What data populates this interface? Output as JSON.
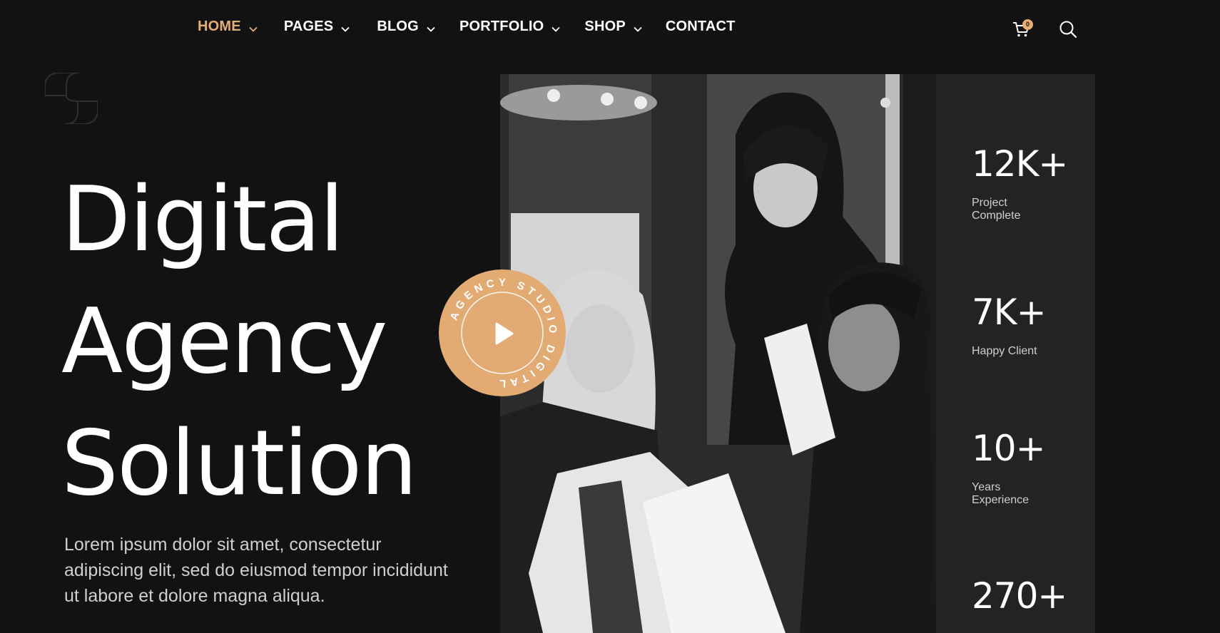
{
  "nav": {
    "items": [
      {
        "label": "HOME",
        "active": true,
        "has_dropdown": true
      },
      {
        "label": "PAGES",
        "active": false,
        "has_dropdown": true
      },
      {
        "label": "BLOG",
        "active": false,
        "has_dropdown": true
      },
      {
        "label": "PORTFOLIO",
        "active": false,
        "has_dropdown": true
      },
      {
        "label": "SHOP",
        "active": false,
        "has_dropdown": true
      },
      {
        "label": "CONTACT",
        "active": false,
        "has_dropdown": false
      }
    ],
    "cart_count": "0",
    "icons": [
      "chevron-down-icon",
      "cart-icon",
      "search-icon"
    ]
  },
  "hero": {
    "title_lines": [
      "Digital",
      "Agency",
      "Solution"
    ],
    "description": "Lorem ipsum dolor sit amet, consectetur adipiscing elit, sed do eiusmod tempor incididunt ut labore et dolore magna aliqua."
  },
  "play_badge": {
    "ring_text": "AGENCY STUDIO DIGITAL",
    "icon": "play-icon"
  },
  "stats": [
    {
      "value": "12K+",
      "label": "Project Complete"
    },
    {
      "value": "7K+",
      "label": "Happy Client"
    },
    {
      "value": "10+",
      "label": "Years Experience"
    },
    {
      "value": "270+",
      "label": ""
    }
  ],
  "colors": {
    "background": "#121212",
    "accent": "#e8ad74",
    "stats_panel": "#232323",
    "text": "#ffffff",
    "muted_text": "#cfcfcf"
  }
}
